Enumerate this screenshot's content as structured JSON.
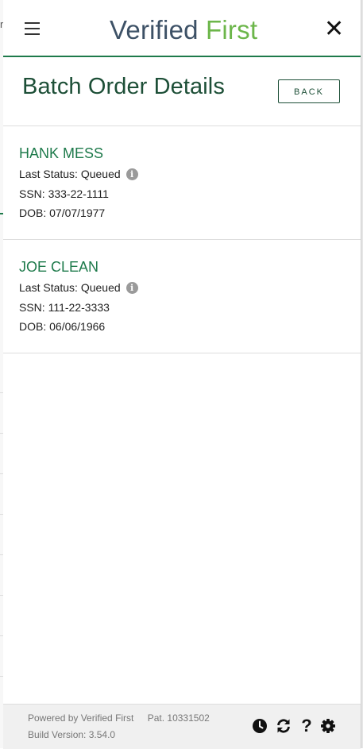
{
  "header": {
    "logo_part1": "Verified",
    "logo_part2": "First",
    "close_glyph": "✕"
  },
  "page": {
    "title": "Batch Order Details",
    "back_label": "BACK"
  },
  "orders": [
    {
      "name": "HANK MESS",
      "status_label": "Last Status:",
      "status": "Queued",
      "ssn_label": "SSN:",
      "ssn": "333-22-1111",
      "dob_label": "DOB:",
      "dob": "07/07/1977"
    },
    {
      "name": "JOE CLEAN",
      "status_label": "Last Status:",
      "status": "Queued",
      "ssn_label": "SSN:",
      "ssn": "111-22-3333",
      "dob_label": "DOB:",
      "dob": "06/06/1966"
    }
  ],
  "footer": {
    "powered_by": "Powered by Verified First",
    "patent": "Pat. 10331502",
    "build_version": "Build Version: 3.54.0",
    "help_glyph": "?"
  },
  "icons": {
    "menu": "hamburger-menu-icon",
    "close": "close-icon",
    "info": "info-icon",
    "history": "clock-icon",
    "refresh": "refresh-icon",
    "help": "question-icon",
    "settings": "gear-icon"
  },
  "colors": {
    "brand_green": "#1e7a4b",
    "title_green": "#1d4f37",
    "logo_dark": "#3d5166",
    "logo_light": "#6cb64a"
  }
}
